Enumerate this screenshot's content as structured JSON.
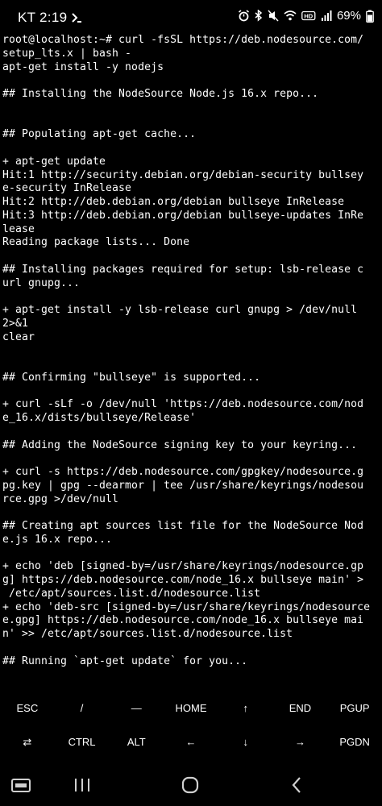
{
  "status_bar": {
    "time": "KT 2:19",
    "battery": "69%"
  },
  "terminal": {
    "lines": [
      "root@localhost:~# curl -fsSL https://deb.nodesource.com/",
      "setup_lts.x | bash -",
      "apt-get install -y nodejs",
      "",
      "## Installing the NodeSource Node.js 16.x repo...",
      "",
      "",
      "## Populating apt-get cache...",
      "",
      "+ apt-get update",
      "Hit:1 http://security.debian.org/debian-security bullsey",
      "e-security InRelease",
      "Hit:2 http://deb.debian.org/debian bullseye InRelease",
      "Hit:3 http://deb.debian.org/debian bullseye-updates InRe",
      "lease",
      "Reading package lists... Done",
      "",
      "## Installing packages required for setup: lsb-release c",
      "url gnupg...",
      "",
      "+ apt-get install -y lsb-release curl gnupg > /dev/null",
      "2>&1",
      "clear",
      "",
      "",
      "## Confirming \"bullseye\" is supported...",
      "",
      "+ curl -sLf -o /dev/null 'https://deb.nodesource.com/nod",
      "e_16.x/dists/bullseye/Release'",
      "",
      "## Adding the NodeSource signing key to your keyring...",
      "",
      "+ curl -s https://deb.nodesource.com/gpgkey/nodesource.g",
      "pg.key | gpg --dearmor | tee /usr/share/keyrings/nodesou",
      "rce.gpg >/dev/null",
      "",
      "## Creating apt sources list file for the NodeSource Nod",
      "e.js 16.x repo...",
      "",
      "+ echo 'deb [signed-by=/usr/share/keyrings/nodesource.gp",
      "g] https://deb.nodesource.com/node_16.x bullseye main' >",
      " /etc/apt/sources.list.d/nodesource.list",
      "+ echo 'deb-src [signed-by=/usr/share/keyrings/nodesource",
      "e.gpg] https://deb.nodesource.com/node_16.x bullseye mai",
      "n' >> /etc/apt/sources.list.d/nodesource.list",
      "",
      "## Running `apt-get update` for you..."
    ]
  },
  "extra_keys": {
    "row1": [
      "ESC",
      "/",
      "—",
      "HOME",
      "↑",
      "END",
      "PGUP"
    ],
    "row2": [
      "⇄",
      "CTRL",
      "ALT",
      "←",
      "↓",
      "→",
      "PGDN"
    ]
  }
}
